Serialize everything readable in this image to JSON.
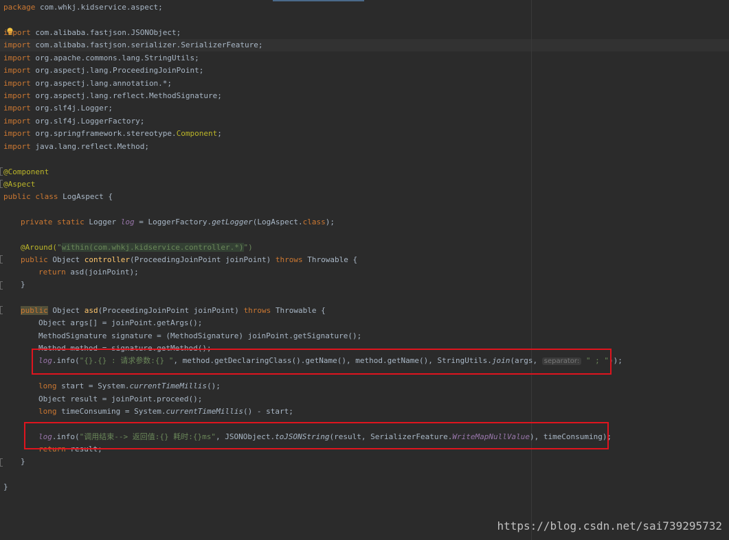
{
  "colors": {
    "background": "#2b2b2b",
    "keyword": "#cc7832",
    "string": "#6a8759",
    "annotation": "#bbb529",
    "static_field": "#9876aa",
    "method_decl": "#ffc66d",
    "highlight_box": "#e0141e"
  },
  "code": {
    "pkg": {
      "kw": "package",
      "name": "com.whkj.kidservice.aspect;"
    },
    "imports": [
      {
        "kw": "import",
        "path": "com.alibaba.fastjson.JSONObject;"
      },
      {
        "kw": "import",
        "path": "com.alibaba.fastjson.serializer.SerializerFeature;"
      },
      {
        "kw": "import",
        "path": "org.apache.commons.lang.StringUtils;"
      },
      {
        "kw": "import",
        "path": "org.aspectj.lang.ProceedingJoinPoint;"
      },
      {
        "kw": "import",
        "path": "org.aspectj.lang.annotation.*;"
      },
      {
        "kw": "import",
        "path": "org.aspectj.lang.reflect.MethodSignature;"
      },
      {
        "kw": "import",
        "path": "org.slf4j.Logger;"
      },
      {
        "kw": "import",
        "path": "org.slf4j.LoggerFactory;"
      },
      {
        "kw": "import",
        "path": "org.springframework.stereotype.",
        "path_hl": "Component",
        "end": ";"
      },
      {
        "kw": "import",
        "path": "java.lang.reflect.Method;"
      }
    ],
    "ann_component": "@Component",
    "ann_aspect": "@Aspect",
    "class_decl": {
      "kw": "public class",
      "name": "LogAspect {"
    },
    "logger_field": {
      "kw": "private static",
      "type": "Logger",
      "var": "log",
      "eq": "= LoggerFactory.",
      "method": "getLogger",
      "arg": "(LogAspect.",
      "cls": "class",
      "end": ");"
    },
    "around": {
      "ann": "@Around(",
      "open": "\"",
      "within": "within",
      "expr": "(com.whkj.kidservice.controller.*)",
      "close": "\")"
    },
    "controller_decl": {
      "kw": "public",
      "ret": "Object",
      "name": "controller",
      "params": "(ProceedingJoinPoint joinPoint)",
      "throws_kw": "throws",
      "throws_type": "Throwable {"
    },
    "return_asd": {
      "kw": "return",
      "expr": "asd(joinPoint);"
    },
    "close_brace": "}",
    "asd_decl": {
      "kw": "public",
      "ret": "Object",
      "name": "asd",
      "params": "(ProceedingJoinPoint joinPoint)",
      "throws_kw": "throws",
      "throws_type": "Throwable {"
    },
    "args_line": "Object args[] = joinPoint.getArgs();",
    "signature_line": "MethodSignature signature = (MethodSignature) joinPoint.getSignature();",
    "method_line": "Method method = signature.getMethod();",
    "log_info_1": {
      "log": "log",
      "call": ".info(",
      "str": "\"{}.{} : 请求参数:{} \"",
      "mid": ", method.getDeclaringClass().getName(), method.getName(), StringUtils.",
      "join": "join",
      "args": "(args, ",
      "hint": "separator:",
      "sep": "\" ; \"",
      "end": "));"
    },
    "start_line": {
      "kw": "long",
      "pre": "start = System.",
      "m": "currentTimeMillis",
      "end": "();"
    },
    "result_line": "Object result = joinPoint.proceed();",
    "time_line": {
      "kw": "long",
      "pre": "timeConsuming = System.",
      "m": "currentTimeMillis",
      "end": "() - start;"
    },
    "log_info_2": {
      "log": "log",
      "call": ".info(",
      "str": "\"调用结束--> 返回值:{} 耗时:{}ms\"",
      "mid": ", JSONObject.",
      "m": "toJSONString",
      "args": "(result, SerializerFeature.",
      "fld": "WriteMapNullValue",
      "end": "), timeConsuming);"
    },
    "return_result": {
      "kw": "return",
      "expr": "result;"
    },
    "method_close": "}",
    "class_close": "}"
  },
  "watermark": "https://blog.csdn.net/sai739295732"
}
